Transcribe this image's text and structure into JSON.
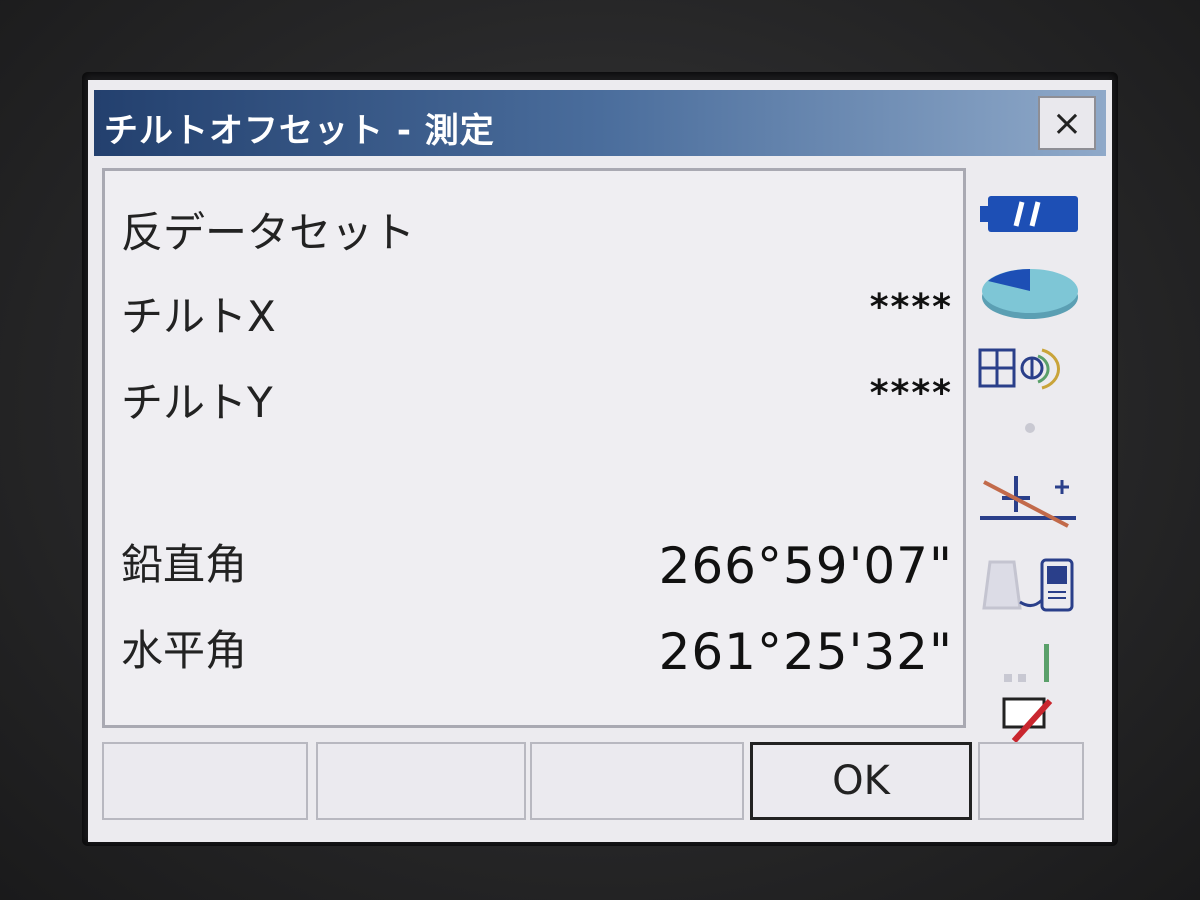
{
  "window": {
    "title": "チルトオフセット - 測定",
    "close_symbol": "×"
  },
  "rows": [
    {
      "label": "反データセット",
      "value": ""
    },
    {
      "label": "チルトX",
      "value": "****"
    },
    {
      "label": "チルトY",
      "value": "****"
    },
    {
      "label": "鉛直角",
      "value": "266°59'07\""
    },
    {
      "label": "水平角",
      "value": "261°25'32\""
    }
  ],
  "softkeys": [
    "",
    "",
    "",
    "OK",
    ""
  ],
  "status_icons": [
    "battery-icon",
    "disk-icon",
    "level-icon",
    "dot-icon",
    "laser-plummet-icon",
    "device-connection-icon",
    "signal-icon",
    "input-pen-icon"
  ],
  "colors": {
    "titlebar_start": "#23406e",
    "titlebar_end": "#8fa9c9",
    "display_bg": "#ecebef",
    "battery": "#1d4fb5",
    "disk": "#6fb8c9"
  }
}
